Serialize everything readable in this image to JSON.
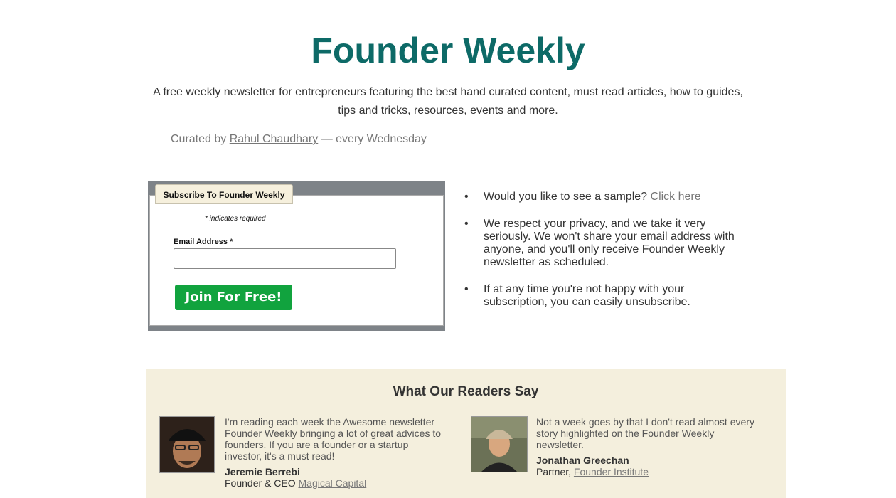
{
  "header": {
    "title": "Founder Weekly",
    "tagline": "A free weekly newsletter for entrepreneurs featuring the best hand curated content, must read articles, how to guides, tips and tricks, resources, events and more.",
    "curated_prefix": "Curated by",
    "curator_name": "Rahul Chaudhary",
    "curated_suffix": "— every Wednesday"
  },
  "subscribe_form": {
    "tab_label": "Subscribe To Founder Weekly",
    "required_note": "* indicates required",
    "email_label": "Email Address *",
    "email_value": "",
    "submit_label": "Join For Free!"
  },
  "info_bullets": {
    "sample_text": "Would you like to see a sample?",
    "sample_link": "Click here",
    "privacy_text": "We respect your privacy, and we take it very seriously. We won't share your email address with anyone, and you'll only receive Founder Weekly newsletter as scheduled.",
    "unsubscribe_text": "If at any time you're not happy with your subscription, you can easily unsubscribe."
  },
  "testimonials": {
    "heading": "What Our Readers Say",
    "items": [
      {
        "quote": "I'm reading each week the Awesome newsletter Founder Weekly bringing a lot of great advices to founders. If you are a founder or a startup investor, it's a must read!",
        "name": "Jeremie Berrebi",
        "role": "Founder & CEO",
        "company": "Magical Capital"
      },
      {
        "quote": "Not a week goes by that I don't read almost every story highlighted on the Founder Weekly newsletter.",
        "name": "Jonathan Greechan",
        "role": "Partner,",
        "company": "Founder Institute"
      }
    ]
  },
  "colors": {
    "brand_teal": "#0d6a67",
    "button_green": "#11a33e",
    "testimonial_bg": "#f4efdd"
  }
}
